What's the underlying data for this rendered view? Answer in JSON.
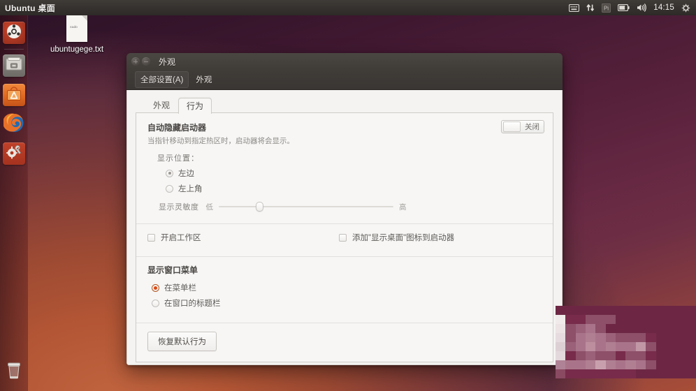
{
  "top_panel": {
    "title": "Ubuntu 桌面",
    "indicators": [
      {
        "name": "keyboard-indicator-icon",
        "glyph": "keyboard"
      },
      {
        "name": "network-indicator-icon",
        "glyph": "network"
      },
      {
        "name": "input-method-indicator",
        "glyph": "Pi"
      },
      {
        "name": "battery-indicator-icon",
        "glyph": "battery"
      },
      {
        "name": "volume-indicator-icon",
        "glyph": "volume"
      }
    ],
    "clock": "14:15",
    "session_menu_icon": "gear-icon"
  },
  "launcher": {
    "items": [
      {
        "name": "dash-home",
        "icon": "ubuntu-logo-icon"
      },
      {
        "name": "files",
        "icon": "file-manager-icon"
      },
      {
        "name": "software-center",
        "icon": "ubuntu-software-icon"
      },
      {
        "name": "firefox",
        "icon": "firefox-icon"
      },
      {
        "name": "system-settings",
        "icon": "system-settings-icon"
      }
    ],
    "trash": {
      "name": "trash",
      "icon": "trash-icon"
    }
  },
  "desktop": {
    "file_icon": {
      "label": "ubuntugege.txt",
      "thumb_text": "sudo"
    }
  },
  "window": {
    "title": "外观",
    "buttons": {
      "close": "close-button",
      "minimize": "minimize-button"
    },
    "toolbar": {
      "all_settings": "全部设置(A)",
      "breadcrumb": "外观"
    },
    "tabs": [
      {
        "label": "外观",
        "active": false
      },
      {
        "label": "行为",
        "active": true
      }
    ],
    "autohide": {
      "title": "自动隐藏启动器",
      "description": "当指针移动到指定热区时，启动器将会显示。",
      "toggle_label": "关闭",
      "toggle_state": "off",
      "position_label": "显示位置：",
      "position_options": [
        {
          "label": "左边",
          "selected": true
        },
        {
          "label": "左上角",
          "selected": false
        }
      ],
      "sensitivity_label": "显示灵敏度",
      "sensitivity_low": "低",
      "sensitivity_high": "高",
      "sensitivity_value": 23
    },
    "checkboxes": [
      {
        "label": "开启工作区",
        "checked": false
      },
      {
        "label": "添加\"显示桌面\"图标到启动器",
        "checked": false
      }
    ],
    "window_menu": {
      "title": "显示窗口菜单",
      "options": [
        {
          "label": "在菜单栏",
          "selected": true
        },
        {
          "label": "在窗口的标题栏",
          "selected": false
        }
      ]
    },
    "restore_button": "恢复默认行为"
  },
  "colors": {
    "accent_orange": "#dd4814",
    "panel_bg": "#3a3633",
    "window_bg": "#f7f6f5",
    "desktop_purple": "#55203a",
    "desktop_orange": "#b35635"
  },
  "mosaic": {
    "description": "pixelated-censored-watermark",
    "cells": [
      "#6d2744",
      "#6d2744",
      "#6d2744",
      "#6d2744",
      "#6d2744",
      "#6d2744",
      "#6d2744",
      "#6d2744",
      "#6d2744",
      "#6d2744",
      "#6d2744",
      "#6d2744",
      "#6d2744",
      "#6d2744",
      "#f0eaea",
      "#782b4b",
      "#782b4b",
      "#8d5068",
      "#8d5068",
      "#8d5068",
      "#6d2744",
      "#6d2744",
      "#6d2744",
      "#6d2744",
      "#6d2744",
      "#6d2744",
      "#6d2744",
      "#6d2744",
      "#ece3e5",
      "#8d5068",
      "#9a6179",
      "#a97489",
      "#8d5068",
      "#6d2744",
      "#6d2744",
      "#6d2744",
      "#6d2744",
      "#6d2744",
      "#6d2744",
      "#6d2744",
      "#6d2744",
      "#6d2744",
      "#e6dcdf",
      "#8d5068",
      "#a97489",
      "#b07f92",
      "#a97489",
      "#9a6179",
      "#8d5068",
      "#8d5068",
      "#8d5068",
      "#782b4b",
      "#6d2744",
      "#6d2744",
      "#6d2744",
      "#6d2744",
      "#ddd0d4",
      "#9a6179",
      "#a97489",
      "#bd8e9e",
      "#a97489",
      "#b07f92",
      "#a97489",
      "#a97489",
      "#c197a6",
      "#8d5068",
      "#6d2744",
      "#6d2744",
      "#6d2744",
      "#6d2744",
      "#e3d8db",
      "#782b4b",
      "#8d5068",
      "#9a6179",
      "#8d5068",
      "#8d5068",
      "#782b4b",
      "#8d5068",
      "#8d5068",
      "#782b4b",
      "#6d2744",
      "#6d2744",
      "#6d2744",
      "#6d2744",
      "#b08296",
      "#a97489",
      "#a97489",
      "#b07f92",
      "#c8a0ad",
      "#b07f92",
      "#a97489",
      "#b07f92",
      "#a97489",
      "#8d5068",
      "#6d2744",
      "#6d2744",
      "#6d2744",
      "#6d2744",
      "#8a4a62",
      "#782b4b",
      "#782b4b",
      "#782b4b",
      "#782b4b",
      "#782b4b",
      "#782b4b",
      "#782b4b",
      "#6d2744",
      "#6d2744",
      "#6d2744",
      "#6d2744",
      "#6d2744",
      "#6d2744"
    ]
  }
}
